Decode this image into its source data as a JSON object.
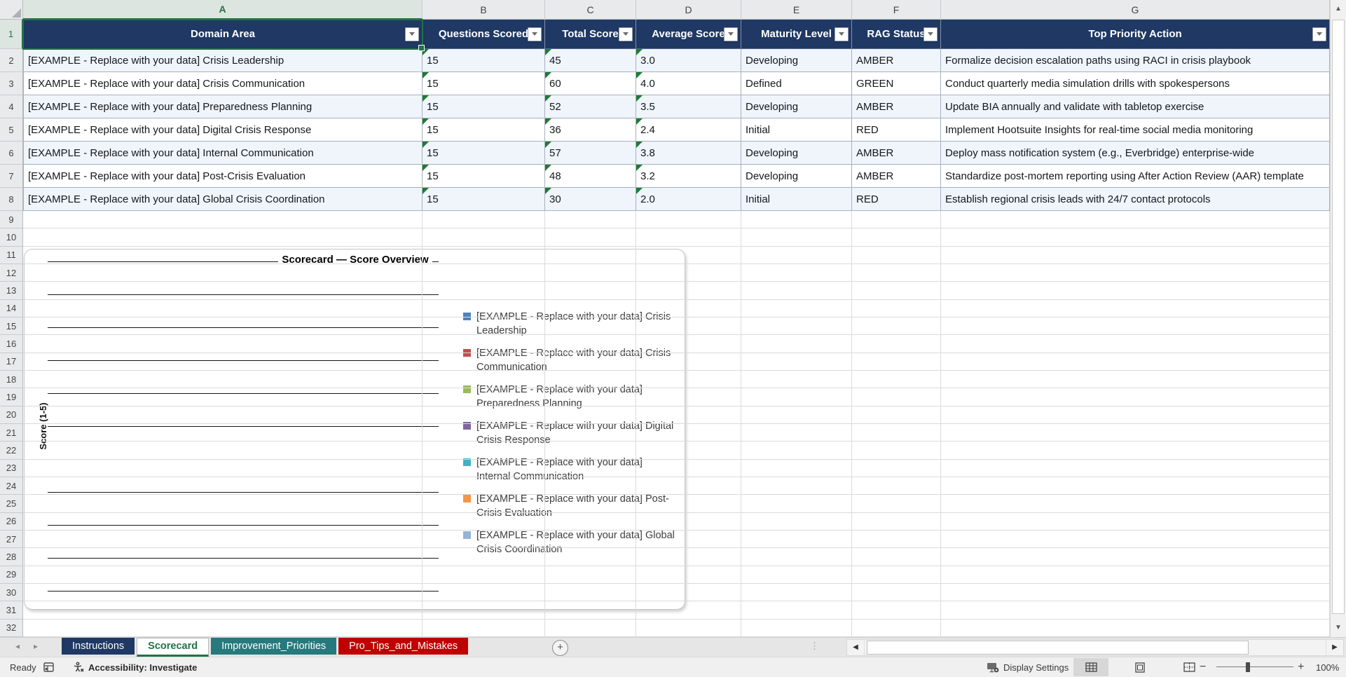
{
  "grid": {
    "column_letters": [
      "A",
      "B",
      "C",
      "D",
      "E",
      "F",
      "G"
    ],
    "row_count": 32,
    "selected_cell": "A1"
  },
  "table": {
    "headers": [
      "Domain Area",
      "Questions Scored",
      "Total Score",
      "Average Score",
      "Maturity Level",
      "RAG Status",
      "Top Priority Action"
    ],
    "rows": [
      [
        "[EXAMPLE - Replace with your data] Crisis Leadership",
        "15",
        "45",
        "3.0",
        "Developing",
        "AMBER",
        "Formalize decision escalation paths using RACI in crisis playbook"
      ],
      [
        "[EXAMPLE - Replace with your data] Crisis Communication",
        "15",
        "60",
        "4.0",
        "Defined",
        "GREEN",
        "Conduct quarterly media simulation drills with spokespersons"
      ],
      [
        "[EXAMPLE - Replace with your data] Preparedness Planning",
        "15",
        "52",
        "3.5",
        "Developing",
        "AMBER",
        "Update BIA annually and validate with tabletop exercise"
      ],
      [
        "[EXAMPLE - Replace with your data] Digital Crisis Response",
        "15",
        "36",
        "2.4",
        "Initial",
        "RED",
        "Implement Hootsuite Insights for real-time social media monitoring"
      ],
      [
        "[EXAMPLE - Replace with your data] Internal Communication",
        "15",
        "57",
        "3.8",
        "Developing",
        "AMBER",
        "Deploy mass notification system (e.g., Everbridge) enterprise-wide"
      ],
      [
        "[EXAMPLE - Replace with your data] Post-Crisis Evaluation",
        "15",
        "48",
        "3.2",
        "Developing",
        "AMBER",
        "Standardize post-mortem reporting using After Action Review (AAR) template"
      ],
      [
        "[EXAMPLE - Replace with your data] Global Crisis Coordination",
        "15",
        "30",
        "2.0",
        "Initial",
        "RED",
        "Establish regional crisis leads with 24/7 contact protocols"
      ]
    ],
    "comment_flag_columns": [
      1,
      2,
      3
    ]
  },
  "chart": {
    "title": "Scorecard — Score Overview",
    "y_axis_label": "Score (1-5)",
    "legend": [
      "[EXAMPLE - Replace with your data] Crisis Leadership",
      "[EXAMPLE - Replace with your data] Crisis Communication",
      "[EXAMPLE - Replace with your data] Preparedness Planning",
      "[EXAMPLE - Replace with your data] Digital Crisis Response",
      "[EXAMPLE - Replace with your data] Internal Communication",
      "[EXAMPLE - Replace with your data] Post-Crisis Evaluation",
      "[EXAMPLE - Replace with your data] Global Crisis Coordination"
    ],
    "legend_colors": [
      "#4F81BD",
      "#C0504D",
      "#9BBB59",
      "#8064A2",
      "#4BACC6",
      "#F79646",
      "#95B3D7"
    ]
  },
  "chart_data": {
    "type": "bar",
    "title": "Scorecard — Score Overview",
    "xlabel": "",
    "ylabel": "Score (1-5)",
    "ylim": [
      1,
      5
    ],
    "grid": true,
    "legend_position": "right",
    "series": [
      {
        "name": "[EXAMPLE - Replace with your data] Crisis Leadership",
        "values": []
      },
      {
        "name": "[EXAMPLE - Replace with your data] Crisis Communication",
        "values": []
      },
      {
        "name": "[EXAMPLE - Replace with your data] Preparedness Planning",
        "values": []
      },
      {
        "name": "[EXAMPLE - Replace with your data] Digital Crisis Response",
        "values": []
      },
      {
        "name": "[EXAMPLE - Replace with your data] Internal Communication",
        "values": []
      },
      {
        "name": "[EXAMPLE - Replace with your data] Post-Crisis Evaluation",
        "values": []
      },
      {
        "name": "[EXAMPLE - Replace with your data] Global Crisis Coordination",
        "values": []
      }
    ],
    "note": "Plot area shows only horizontal gridlines; no bars are rendered in the screenshot."
  },
  "sheet_tabs": {
    "items": [
      {
        "label": "Instructions",
        "bg": "#1F3864",
        "fg": "#FFFFFF",
        "active": false
      },
      {
        "label": "Scorecard",
        "bg": "#FFFFFF",
        "fg": "#217346",
        "active": true
      },
      {
        "label": "Improvement_Priorities",
        "bg": "#26797C",
        "fg": "#FFFFFF",
        "active": false
      },
      {
        "label": "Pro_Tips_and_Mistakes",
        "bg": "#C00000",
        "fg": "#FFFFFF",
        "active": false
      }
    ],
    "add_sheet_label": "+"
  },
  "status_bar": {
    "ready": "Ready",
    "accessibility": "Accessibility: Investigate",
    "display_settings": "Display Settings",
    "zoom_percent": "100%",
    "zoom_out": "−",
    "zoom_in": "+"
  },
  "colors": {
    "table_header_bg": "#1F3864",
    "row_stripe": "#EFF5FB",
    "selection_green": "#217346",
    "comment_flag_green": "#1E7B34"
  }
}
